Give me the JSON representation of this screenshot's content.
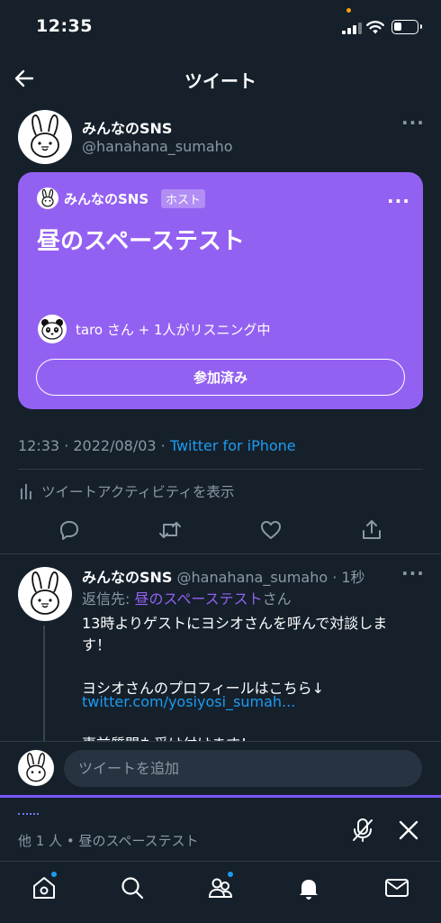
{
  "status_bar": {
    "time": "12:35"
  },
  "header": {
    "title": "ツイート",
    "back_icon": "arrow-left-icon"
  },
  "author": {
    "name": "みんなのSNS",
    "handle": "@hanahana_sumaho",
    "more": "···"
  },
  "space_card": {
    "host_name": "みんなのSNS",
    "host_badge": "ホスト",
    "more": "···",
    "title": "昼のスペーステスト",
    "listeners": "taro さん + 1人がリスニング中",
    "button_label": "参加済み",
    "color": "#9361f2"
  },
  "meta": {
    "datetime": "12:33 · 2022/08/03 · ",
    "source": "Twitter for iPhone"
  },
  "activity": {
    "label": "ツイートアクティビティを表示"
  },
  "actions": [
    "reply-icon",
    "retweet-icon",
    "like-icon",
    "share-icon"
  ],
  "reply": {
    "name": "みんなのSNS",
    "handle_time": " @hanahana_sumaho · 1秒",
    "more": "···",
    "reply_prefix": "返信先: ",
    "reply_target": "昼のスペーステスト",
    "reply_suffix": "さん",
    "text": "13時よりゲストにヨシオさんを呼んで対談します！\n\nヨシオさんのプロフィールはこちら↓",
    "link": "twitter.com/yosiyosi_sumah...",
    "cut_text": "事前質問も受け付けます！"
  },
  "compose": {
    "placeholder": "ツイートを追加"
  },
  "space_dock": {
    "text": "他 1 人 • 昼のスペーステスト"
  },
  "tabbar": [
    "home-icon",
    "search-icon",
    "spaces-icon",
    "notifications-icon",
    "messages-icon"
  ],
  "colors": {
    "background": "#15202b",
    "accent": "#1d9bf0",
    "space": "#9361f2"
  }
}
